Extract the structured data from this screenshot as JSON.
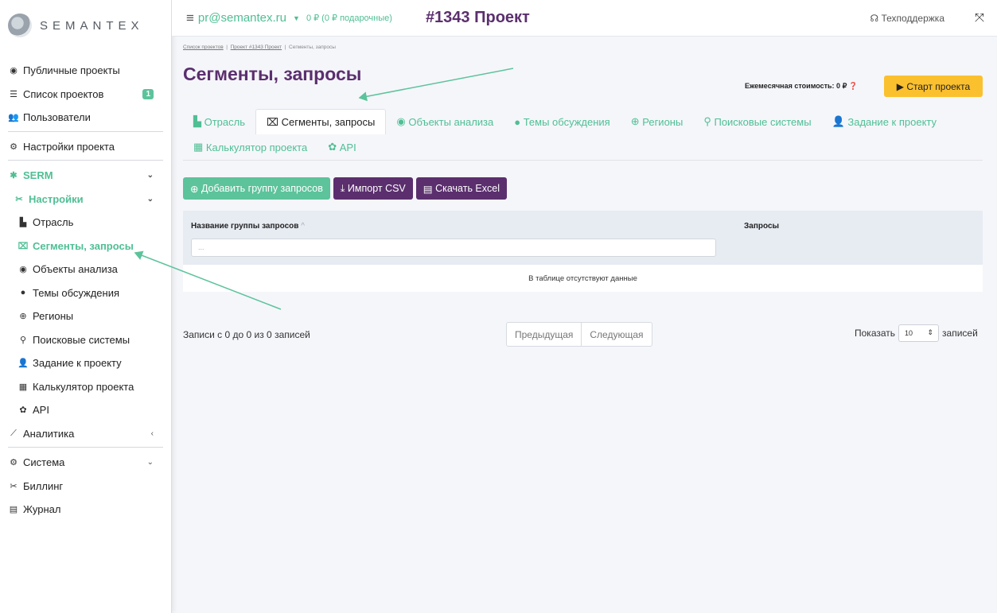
{
  "brand": {
    "name": "SEMANTEX"
  },
  "topbar": {
    "email": "pr@semantex.ru",
    "balance": "0 ₽ (0 ₽ подарочные)",
    "project_title": "#1343 Проект",
    "support": "Техподдержка"
  },
  "sidebar": {
    "items": [
      {
        "label": "Публичные проекты",
        "icon": "eye-icon"
      },
      {
        "label": "Список проектов",
        "icon": "list-icon",
        "badge": "1"
      },
      {
        "label": "Пользователи",
        "icon": "users-icon"
      },
      {
        "label": "Настройки проекта",
        "icon": "gears-icon"
      },
      {
        "label": "SERM",
        "icon": "bug-icon"
      },
      {
        "label": "Настройки",
        "icon": "tools-icon"
      },
      {
        "label": "Отрасль",
        "icon": "industry-icon"
      },
      {
        "label": "Сегменты, запросы",
        "icon": "object-group-icon"
      },
      {
        "label": "Объекты анализа",
        "icon": "target-icon"
      },
      {
        "label": "Темы обсуждения",
        "icon": "comments-icon"
      },
      {
        "label": "Регионы",
        "icon": "globe-icon"
      },
      {
        "label": "Поисковые системы",
        "icon": "search-icon"
      },
      {
        "label": "Задание к проекту",
        "icon": "user-edit-icon"
      },
      {
        "label": "Калькулятор проекта",
        "icon": "calculator-icon"
      },
      {
        "label": "API",
        "icon": "gear-icon"
      },
      {
        "label": "Аналитика",
        "icon": "chart-icon"
      },
      {
        "label": "Система",
        "icon": "gears-icon"
      },
      {
        "label": "Биллинг",
        "icon": "tools-icon"
      },
      {
        "label": "Журнал",
        "icon": "journal-icon"
      }
    ]
  },
  "breadcrumb": [
    "Список проектов",
    "Проект #1343 Проект",
    "Сегменты, запросы"
  ],
  "page": {
    "title": "Сегменты, запросы",
    "monthly_cost": "Ежемесячная стоимость: 0 ₽",
    "start_button": "Старт проекта"
  },
  "tabs": [
    {
      "label": "Отрасль",
      "icon": "industry-icon"
    },
    {
      "label": "Сегменты, запросы",
      "icon": "object-group-icon"
    },
    {
      "label": "Объекты анализа",
      "icon": "target-icon"
    },
    {
      "label": "Темы обсуждения",
      "icon": "comments-icon"
    },
    {
      "label": "Регионы",
      "icon": "globe-icon"
    },
    {
      "label": "Поисковые системы",
      "icon": "search-icon"
    },
    {
      "label": "Задание к проекту",
      "icon": "user-edit-icon"
    },
    {
      "label": "Калькулятор проекта",
      "icon": "calculator-icon"
    },
    {
      "label": "API",
      "icon": "gear-icon"
    }
  ],
  "actions": {
    "add_group": "Добавить группу запросов",
    "import_csv": "Импорт CSV",
    "download_excel": "Скачать Excel"
  },
  "table": {
    "col_group": "Название группы запросов",
    "col_queries": "Запросы",
    "filter_placeholder": "...",
    "empty": "В таблице отсутствуют данные"
  },
  "pagination": {
    "info": "Записи с 0 до 0 из 0 записей",
    "prev": "Предыдущая",
    "next": "Следующая",
    "show_label": "Показать",
    "page_size": "10",
    "records_label": "записей"
  },
  "colors": {
    "accent_green": "#4fbf94",
    "brand_purple": "#5b2f6e",
    "start_yellow": "#fbc02d",
    "annotation_arrow": "#5cc39b"
  }
}
